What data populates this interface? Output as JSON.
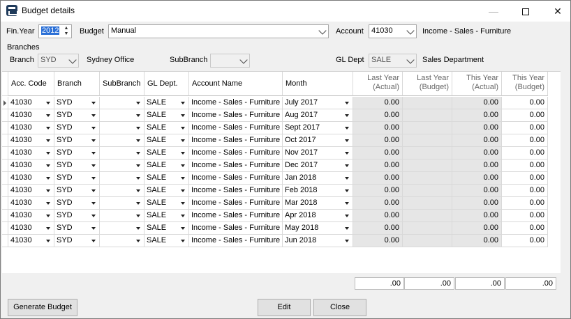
{
  "window": {
    "title": "Budget details"
  },
  "header": {
    "fin_year_label": "Fin.Year",
    "fin_year_value": "2012",
    "budget_label": "Budget",
    "budget_value": "Manual",
    "account_label": "Account",
    "account_value": "41030",
    "account_name": "Income - Sales - Furniture"
  },
  "branches": {
    "section_label": "Branches",
    "branch_label": "Branch",
    "branch_value": "SYD",
    "branch_name": "Sydney Office",
    "subbranch_label": "SubBranch",
    "subbranch_value": "",
    "gl_dept_label": "GL Dept",
    "gl_dept_value": "SALE",
    "gl_dept_name": "Sales Department"
  },
  "grid": {
    "columns": [
      "Acc. Code",
      "Branch",
      "SubBranch",
      "GL Dept.",
      "Account Name",
      "Month",
      [
        "Last Year",
        "(Actual)"
      ],
      [
        "Last Year",
        "(Budget)"
      ],
      [
        "This Year",
        "(Actual)"
      ],
      [
        "This Year",
        "(Budget)"
      ]
    ],
    "rows": [
      {
        "acc": "41030",
        "branch": "SYD",
        "sub": "",
        "dept": "SALE",
        "name": "Income - Sales - Furniture",
        "month": "July 2017",
        "ly_actual": "0.00",
        "ly_budget": "",
        "ty_actual": "0.00",
        "ty_budget": "0.00"
      },
      {
        "acc": "41030",
        "branch": "SYD",
        "sub": "",
        "dept": "SALE",
        "name": "Income - Sales - Furniture",
        "month": "Aug 2017",
        "ly_actual": "0.00",
        "ly_budget": "",
        "ty_actual": "0.00",
        "ty_budget": "0.00"
      },
      {
        "acc": "41030",
        "branch": "SYD",
        "sub": "",
        "dept": "SALE",
        "name": "Income - Sales - Furniture",
        "month": "Sept 2017",
        "ly_actual": "0.00",
        "ly_budget": "",
        "ty_actual": "0.00",
        "ty_budget": "0.00"
      },
      {
        "acc": "41030",
        "branch": "SYD",
        "sub": "",
        "dept": "SALE",
        "name": "Income - Sales - Furniture",
        "month": "Oct 2017",
        "ly_actual": "0.00",
        "ly_budget": "",
        "ty_actual": "0.00",
        "ty_budget": "0.00"
      },
      {
        "acc": "41030",
        "branch": "SYD",
        "sub": "",
        "dept": "SALE",
        "name": "Income - Sales - Furniture",
        "month": "Nov 2017",
        "ly_actual": "0.00",
        "ly_budget": "",
        "ty_actual": "0.00",
        "ty_budget": "0.00"
      },
      {
        "acc": "41030",
        "branch": "SYD",
        "sub": "",
        "dept": "SALE",
        "name": "Income - Sales - Furniture",
        "month": "Dec 2017",
        "ly_actual": "0.00",
        "ly_budget": "",
        "ty_actual": "0.00",
        "ty_budget": "0.00"
      },
      {
        "acc": "41030",
        "branch": "SYD",
        "sub": "",
        "dept": "SALE",
        "name": "Income - Sales - Furniture",
        "month": "Jan 2018",
        "ly_actual": "0.00",
        "ly_budget": "",
        "ty_actual": "0.00",
        "ty_budget": "0.00"
      },
      {
        "acc": "41030",
        "branch": "SYD",
        "sub": "",
        "dept": "SALE",
        "name": "Income - Sales - Furniture",
        "month": "Feb 2018",
        "ly_actual": "0.00",
        "ly_budget": "",
        "ty_actual": "0.00",
        "ty_budget": "0.00"
      },
      {
        "acc": "41030",
        "branch": "SYD",
        "sub": "",
        "dept": "SALE",
        "name": "Income - Sales - Furniture",
        "month": "Mar 2018",
        "ly_actual": "0.00",
        "ly_budget": "",
        "ty_actual": "0.00",
        "ty_budget": "0.00"
      },
      {
        "acc": "41030",
        "branch": "SYD",
        "sub": "",
        "dept": "SALE",
        "name": "Income - Sales - Furniture",
        "month": "Apr 2018",
        "ly_actual": "0.00",
        "ly_budget": "",
        "ty_actual": "0.00",
        "ty_budget": "0.00"
      },
      {
        "acc": "41030",
        "branch": "SYD",
        "sub": "",
        "dept": "SALE",
        "name": "Income - Sales - Furniture",
        "month": "May 2018",
        "ly_actual": "0.00",
        "ly_budget": "",
        "ty_actual": "0.00",
        "ty_budget": "0.00"
      },
      {
        "acc": "41030",
        "branch": "SYD",
        "sub": "",
        "dept": "SALE",
        "name": "Income - Sales - Furniture",
        "month": "Jun 2018",
        "ly_actual": "0.00",
        "ly_budget": "",
        "ty_actual": "0.00",
        "ty_budget": "0.00"
      }
    ],
    "totals": [
      ".00",
      ".00",
      ".00",
      ".00"
    ]
  },
  "footer": {
    "generate_label": "Generate Budget",
    "edit_label": "Edit",
    "close_label": "Close"
  }
}
